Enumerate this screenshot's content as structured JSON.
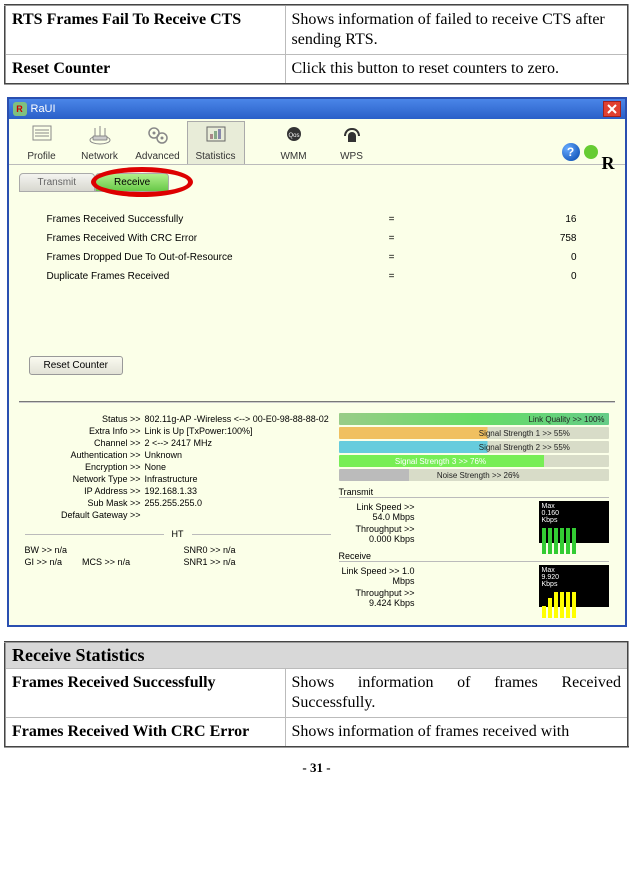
{
  "top_table": {
    "row1_label": "RTS Frames Fail To Receive CTS",
    "row1_desc": "Shows information of failed to receive CTS after sending RTS.",
    "row2_label": "Reset Counter",
    "row2_desc": "Click this button to reset counters to zero."
  },
  "window": {
    "title": "RaUI",
    "toolbar": {
      "profile": "Profile",
      "network": "Network",
      "advanced": "Advanced",
      "statistics": "Statistics",
      "wmm": "WMM",
      "wps": "WPS"
    },
    "tabs": {
      "transmit": "Transmit",
      "receive": "Receive"
    },
    "stats": {
      "r1_lbl": "Frames Received Successfully",
      "r1_val": "16",
      "r2_lbl": "Frames Received With CRC Error",
      "r2_val": "758",
      "r3_lbl": "Frames Dropped Due To Out-of-Resource",
      "r3_val": "0",
      "r4_lbl": "Duplicate Frames Received",
      "r4_val": "0",
      "eq": "="
    },
    "reset_btn": "Reset Counter",
    "info": {
      "status_lbl": "Status >>",
      "status_val": "802.11g-AP -Wireless  <--> 00-E0-98-88-88-02",
      "extra_lbl": "Extra Info >>",
      "extra_val": "Link is Up  [TxPower:100%]",
      "channel_lbl": "Channel >>",
      "channel_val": "2 <--> 2417 MHz",
      "auth_lbl": "Authentication >>",
      "auth_val": "Unknown",
      "enc_lbl": "Encryption >>",
      "enc_val": "None",
      "net_lbl": "Network Type >>",
      "net_val": "Infrastructure",
      "ip_lbl": "IP Address >>",
      "ip_val": "192.168.1.33",
      "mask_lbl": "Sub Mask >>",
      "mask_val": "255.255.255.0",
      "gw_lbl": "Default Gateway >>",
      "gw_val": ""
    },
    "ht": {
      "title": "HT",
      "bw": "BW >> n/a",
      "gi": "GI >> n/a",
      "mcs": "MCS >> n/a",
      "snr0": "SNR0 >> n/a",
      "snr1": "SNR1 >> n/a"
    },
    "bars": {
      "lq": "Link Quality >> 100%",
      "ss1": "Signal Strength 1 >> 55%",
      "ss2": "Signal Strength 2 >> 55%",
      "ss3": "Signal Strength 3 >> 76%",
      "ns": "Noise Strength >> 26%"
    },
    "tx": {
      "title": "Transmit",
      "ls": "Link Speed >> 54.0 Mbps",
      "tp": "Throughput >> 0.000 Kbps",
      "g_max": "Max",
      "g_val": "0.160",
      "g_unit": "Kbps"
    },
    "rx": {
      "title": "Receive",
      "ls": "Link Speed >> 1.0 Mbps",
      "tp": "Throughput >> 9.424 Kbps",
      "g_max": "Max",
      "g_val": "9.920",
      "g_unit": "Kbps"
    },
    "r_corner": "R"
  },
  "bottom_table": {
    "header": "Receive Statistics",
    "row1_label": "Frames Received Successfully",
    "row1_desc": "Shows information of frames Received Successfully.",
    "row2_label": "Frames Received With CRC Error",
    "row2_desc": "Shows information of frames received with"
  },
  "page_number": "- 31 -"
}
